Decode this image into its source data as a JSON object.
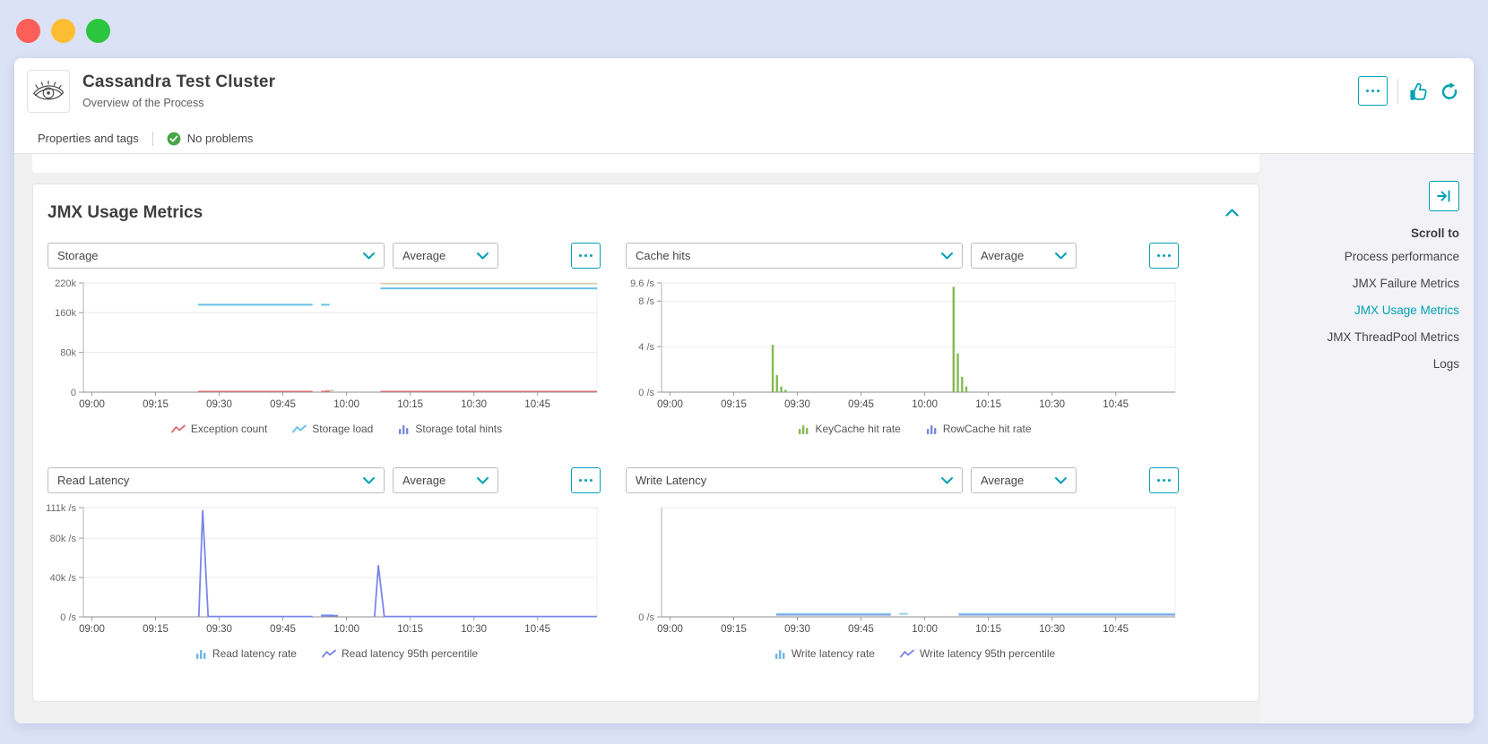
{
  "window_controls": {
    "close_color": "#fb5f57",
    "minimize_color": "#fdbd32",
    "zoom_color": "#2bc63f"
  },
  "accent_color": "#00a1b2",
  "header": {
    "title": "Cassandra Test Cluster",
    "subtitle": "Overview of the Process",
    "logo_icon": "eye-sketch-logo",
    "actions": {
      "more_icon": "ellipsis-icon",
      "like_icon": "thumbs-up-icon",
      "refresh_icon": "refresh-icon"
    }
  },
  "subheader": {
    "properties_label": "Properties and tags",
    "status_label": "No problems",
    "status_icon": "check-circle-icon",
    "status_color": "#46a546"
  },
  "section": {
    "title": "JMX Usage Metrics",
    "collapse_icon": "chevron-up-icon"
  },
  "scroll_panel": {
    "collapse_icon": "collapse-right-icon",
    "heading": "Scroll to",
    "active_color": "#00a1b2",
    "items": [
      {
        "label": "Process performance",
        "active": false
      },
      {
        "label": "JMX Failure Metrics",
        "active": false
      },
      {
        "label": "JMX Usage Metrics",
        "active": true
      },
      {
        "label": "JMX ThreadPool Metrics",
        "active": false
      },
      {
        "label": "Logs",
        "active": false
      }
    ]
  },
  "charts": [
    {
      "metric": "Storage",
      "aggregation": "Average",
      "more_icon": "ellipsis-icon",
      "legend": [
        {
          "label": "Exception count",
          "icon": "line",
          "color": "#de6b76"
        },
        {
          "label": "Storage load",
          "icon": "line",
          "color": "#67c1e8"
        },
        {
          "label": "Storage total hints",
          "icon": "bars",
          "color": "#7b87e0"
        }
      ],
      "chart_data": {
        "type": "line",
        "title": "Storage",
        "t_min": -2,
        "t_max": 119,
        "y_max": 220000,
        "x_ticks": [
          {
            "t": 0,
            "label": "09:00"
          },
          {
            "t": 15,
            "label": "09:15"
          },
          {
            "t": 30,
            "label": "09:30"
          },
          {
            "t": 45,
            "label": "09:45"
          },
          {
            "t": 60,
            "label": "10:00"
          },
          {
            "t": 75,
            "label": "10:15"
          },
          {
            "t": 90,
            "label": "10:30"
          },
          {
            "t": 105,
            "label": "10:45"
          }
        ],
        "y_ticks": [
          {
            "v": 0,
            "label": "0"
          },
          {
            "v": 80000,
            "label": "80k"
          },
          {
            "v": 160000,
            "label": "160k"
          },
          {
            "v": 220000,
            "label": "220k"
          }
        ],
        "series": [
          {
            "name": "Storage total hints",
            "color": "#cbca9e",
            "type": "line",
            "width": 1.4,
            "segments": [
              [
                [
                  68,
                  218500
                ],
                [
                  119,
                  218500
                ]
              ],
              [
                [
                  55,
                  3000
                ],
                [
                  57,
                  3000
                ]
              ]
            ]
          },
          {
            "name": "Exception count",
            "color": "#de6b76",
            "type": "line",
            "width": 1.4,
            "segments": [
              [
                [
                  25,
                  1500
                ],
                [
                  52,
                  1500
                ]
              ],
              [
                [
                  54,
                  1500
                ],
                [
                  56,
                  1500
                ]
              ],
              [
                [
                  68,
                  1500
                ],
                [
                  119,
                  1500
                ]
              ]
            ]
          },
          {
            "name": "Storage load",
            "color": "#67c1e8",
            "type": "line",
            "width": 2,
            "segments": [
              [
                [
                  25,
                  176000
                ],
                [
                  52,
                  176000
                ]
              ],
              [
                [
                  54,
                  176000
                ],
                [
                  56,
                  176000
                ]
              ],
              [
                [
                  68,
                  209000
                ],
                [
                  119,
                  209000
                ]
              ]
            ]
          }
        ]
      }
    },
    {
      "metric": "Cache hits",
      "aggregation": "Average",
      "more_icon": "ellipsis-icon",
      "legend": [
        {
          "label": "KeyCache hit rate",
          "icon": "bars",
          "color": "#85bb50"
        },
        {
          "label": "RowCache hit rate",
          "icon": "bars",
          "color": "#7b87e0"
        }
      ],
      "chart_data": {
        "type": "bar",
        "title": "Cache hits",
        "t_min": -2,
        "t_max": 119,
        "y_max": 9.6,
        "x_ticks": [
          {
            "t": 0,
            "label": "09:00"
          },
          {
            "t": 15,
            "label": "09:15"
          },
          {
            "t": 30,
            "label": "09:30"
          },
          {
            "t": 45,
            "label": "09:45"
          },
          {
            "t": 60,
            "label": "10:00"
          },
          {
            "t": 75,
            "label": "10:15"
          },
          {
            "t": 90,
            "label": "10:30"
          },
          {
            "t": 105,
            "label": "10:45"
          }
        ],
        "y_ticks": [
          {
            "v": 0,
            "label": "0 /s"
          },
          {
            "v": 4,
            "label": "4 /s"
          },
          {
            "v": 8,
            "label": "8 /s"
          },
          {
            "v": 9.6,
            "label": "9.6 /s"
          }
        ],
        "series": [
          {
            "name": "KeyCache hit rate",
            "color": "#85bb50",
            "type": "bars",
            "points": [
              [
                24.2,
                4.15
              ],
              [
                25.2,
                1.5
              ],
              [
                26.2,
                0.5
              ],
              [
                27.2,
                0.2
              ],
              [
                66.8,
                9.25
              ],
              [
                67.8,
                3.4
              ],
              [
                68.8,
                1.35
              ],
              [
                69.8,
                0.5
              ]
            ]
          },
          {
            "name": "RowCache hit rate",
            "color": "#7b87e0",
            "type": "bars",
            "points": []
          }
        ]
      }
    },
    {
      "metric": "Read Latency",
      "aggregation": "Average",
      "more_icon": "ellipsis-icon",
      "legend": [
        {
          "label": "Read latency rate",
          "icon": "bars",
          "color": "#6db7e8"
        },
        {
          "label": "Read latency 95th percentile",
          "icon": "line",
          "color": "#7b86e8"
        }
      ],
      "chart_data": {
        "type": "line",
        "title": "Read Latency",
        "t_min": -2,
        "t_max": 119,
        "y_max": 111000,
        "x_ticks": [
          {
            "t": 0,
            "label": "09:00"
          },
          {
            "t": 15,
            "label": "09:15"
          },
          {
            "t": 30,
            "label": "09:30"
          },
          {
            "t": 45,
            "label": "09:45"
          },
          {
            "t": 60,
            "label": "10:00"
          },
          {
            "t": 75,
            "label": "10:15"
          },
          {
            "t": 90,
            "label": "10:30"
          },
          {
            "t": 105,
            "label": "10:45"
          }
        ],
        "y_ticks": [
          {
            "v": 0,
            "label": "0 /s"
          },
          {
            "v": 40000,
            "label": "40k /s"
          },
          {
            "v": 80000,
            "label": "80k /s"
          },
          {
            "v": 111000,
            "label": "111k /s"
          }
        ],
        "series": [
          {
            "name": "Read latency rate",
            "color": "#8ccbe8",
            "type": "line",
            "width": 1.6,
            "segments": [
              [
                [
                  54,
                  1800
                ],
                [
                  57,
                  1800
                ]
              ]
            ]
          },
          {
            "name": "Read latency 95th percentile",
            "color": "#7b86e8",
            "type": "line",
            "width": 1.8,
            "segments": [
              [
                [
                  25.2,
                  400
                ],
                [
                  26.1,
                  108000
                ],
                [
                  27.4,
                  400
                ],
                [
                  52,
                  400
                ]
              ],
              [
                [
                  54,
                  1200
                ],
                [
                  58,
                  1200
                ]
              ],
              [
                [
                  66.6,
                  400
                ],
                [
                  67.5,
                  52000
                ],
                [
                  68.9,
                  400
                ],
                [
                  119,
                  400
                ]
              ]
            ]
          }
        ]
      }
    },
    {
      "metric": "Write Latency",
      "aggregation": "Average",
      "more_icon": "ellipsis-icon",
      "legend": [
        {
          "label": "Write latency rate",
          "icon": "bars",
          "color": "#6db7e8"
        },
        {
          "label": "Write latency 95th percentile",
          "icon": "line",
          "color": "#7b86e8"
        }
      ],
      "chart_data": {
        "type": "line",
        "title": "Write Latency",
        "t_min": -2,
        "t_max": 119,
        "y_max": 10,
        "x_ticks": [
          {
            "t": 0,
            "label": "09:00"
          },
          {
            "t": 15,
            "label": "09:15"
          },
          {
            "t": 30,
            "label": "09:30"
          },
          {
            "t": 45,
            "label": "09:45"
          },
          {
            "t": 60,
            "label": "10:00"
          },
          {
            "t": 75,
            "label": "10:15"
          },
          {
            "t": 90,
            "label": "10:30"
          },
          {
            "t": 105,
            "label": "10:45"
          }
        ],
        "y_ticks": [
          {
            "v": 0,
            "label": "0 /s"
          }
        ],
        "series": [
          {
            "name": "Write latency 95th percentile",
            "color": "#7b86e8",
            "type": "line",
            "width": 1.5,
            "segments": [
              [
                [
                  25,
                  0.18
                ],
                [
                  52,
                  0.18
                ]
              ],
              [
                [
                  68,
                  0.18
                ],
                [
                  119,
                  0.18
                ]
              ]
            ]
          },
          {
            "name": "Write latency rate",
            "color": "#85cbe8",
            "type": "line",
            "width": 1.8,
            "segments": [
              [
                [
                  25,
                  0.28
                ],
                [
                  52,
                  0.28
                ]
              ],
              [
                [
                  54,
                  0.28
                ],
                [
                  56,
                  0.28
                ]
              ],
              [
                [
                  68,
                  0.28
                ],
                [
                  119,
                  0.28
                ]
              ]
            ]
          }
        ]
      }
    }
  ]
}
